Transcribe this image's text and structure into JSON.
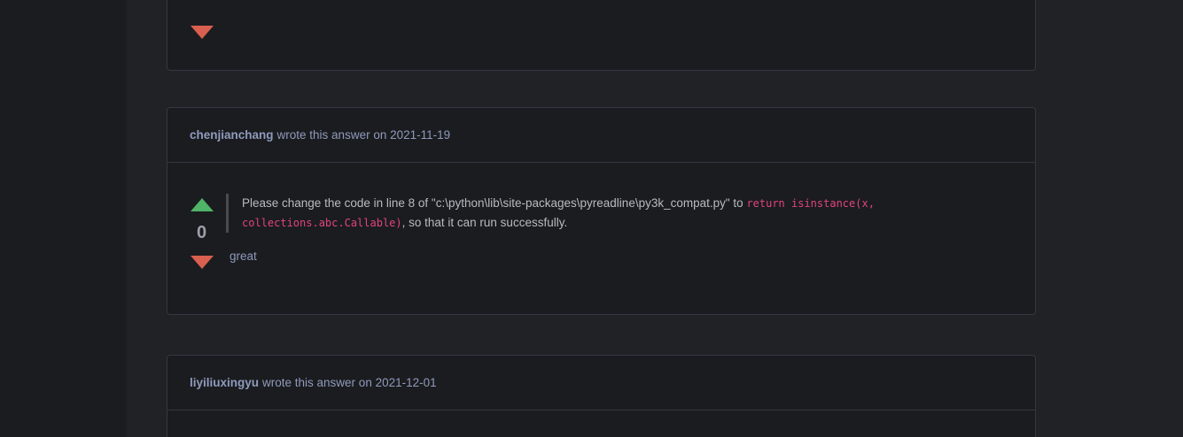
{
  "answers": [
    {
      "author": "chenjianchang",
      "meta": "wrote this answer on 2021-11-19",
      "score": "0",
      "quote": {
        "text_before": "Please change the code in line 8 of \"c:\\python\\lib\\site-packages\\pyreadline\\py3k_compat.py\" to ",
        "code_line1": "return isinstance(x,",
        "code_line2": "collections.abc.Callable)",
        "text_after": ", so that it can run successfully."
      },
      "comment": "great"
    },
    {
      "author": "liyiliuxingyu",
      "meta": "wrote this answer on 2021-12-01"
    }
  ],
  "colors": {
    "upvote": "#4fb368",
    "downvote": "#d9604f",
    "code": "#e0457b",
    "author": "#8f9bbd"
  }
}
